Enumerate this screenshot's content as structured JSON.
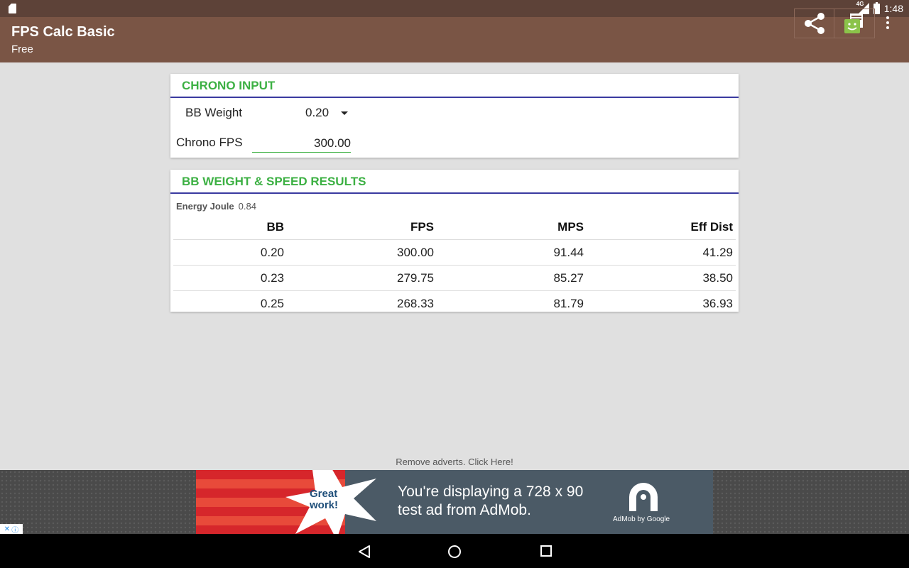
{
  "status_bar": {
    "time": "1:48",
    "network_label": "4G"
  },
  "app_bar": {
    "title": "FPS Calc Basic",
    "subtitle": "Free",
    "share_icon": "share-icon",
    "store_icon": "android-store-icon",
    "overflow_icon": "overflow-menu-icon"
  },
  "chrono_input": {
    "header": "CHRONO INPUT",
    "bb_weight_label": "BB Weight",
    "bb_weight_value": "0.20",
    "chrono_fps_label": "Chrono FPS",
    "chrono_fps_value": "300.00"
  },
  "results": {
    "header": "BB WEIGHT & SPEED RESULTS",
    "energy_label": "Energy Joule",
    "energy_value": "0.84",
    "columns": [
      "BB",
      "FPS",
      "MPS",
      "Eff Dist"
    ],
    "rows": [
      [
        "0.20",
        "300.00",
        "91.44",
        "41.29"
      ],
      [
        "0.23",
        "279.75",
        "85.27",
        "38.50"
      ],
      [
        "0.25",
        "268.33",
        "81.79",
        "36.93"
      ]
    ]
  },
  "remove_ads": "Remove adverts. Click Here!",
  "ad": {
    "badge": [
      "Great",
      "work!"
    ],
    "message": [
      "You're displaying a 728 x 90",
      "test ad from AdMob."
    ],
    "brand": "AdMob by Google"
  },
  "colors": {
    "status_bar": "#5d4238",
    "app_bar": "#7a5545",
    "accent_green": "#3cb043",
    "header_rule": "#3a3aa0"
  }
}
